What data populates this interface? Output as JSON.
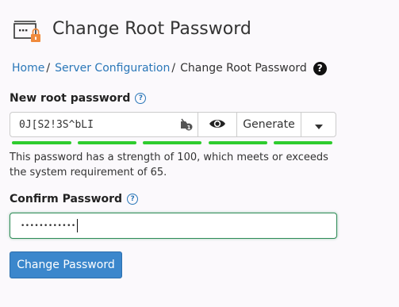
{
  "header": {
    "title": "Change Root Password",
    "icon": "server-lock-icon"
  },
  "breadcrumb": {
    "items": [
      {
        "label": "Home",
        "link": true
      },
      {
        "label": "Server Configuration",
        "link": true
      },
      {
        "label": "Change Root Password",
        "link": false
      }
    ],
    "separator": "/",
    "help_glyph": "?"
  },
  "new_password": {
    "label": "New root password",
    "help_glyph": "?",
    "value": "0J[S2!3S^bLI",
    "generate_label": "Generate",
    "strength_segments": 5,
    "strength_color": "#2ecc2e",
    "strength_message": "This password has a strength of 100, which meets or exceeds the system requirement of 65."
  },
  "confirm_password": {
    "label": "Confirm Password",
    "help_glyph": "?",
    "masked_value": "••••••••••••"
  },
  "submit": {
    "label": "Change Password",
    "color": "#3b87cc"
  }
}
